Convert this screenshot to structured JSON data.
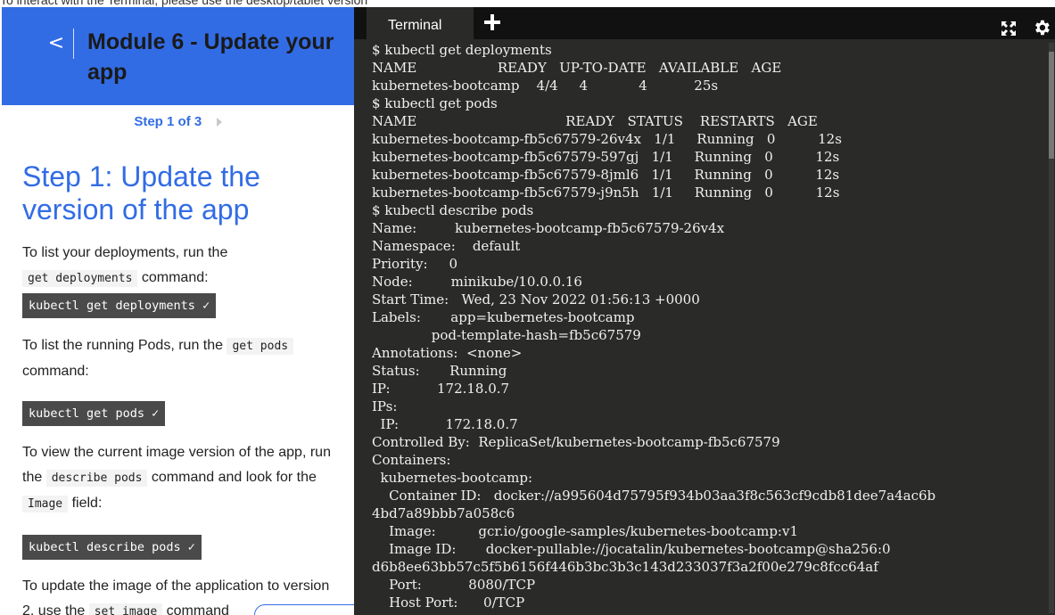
{
  "top_banner": "To interact with the Terminal, please use the desktop/tablet version",
  "left": {
    "back_glyph": "<",
    "module_title": "Module 6 - Update your app",
    "step_label": "Step 1 of 3",
    "step_heading": "Step 1: Update the version of the app",
    "para1_a": "To list your deployments, run the",
    "para1_code": "get deployments",
    "para1_b": "command:",
    "cmd1": "kubectl get deployments ✓",
    "para2_a": "To list the running Pods, run the",
    "para2_code": "get pods",
    "para2_b": "command:",
    "cmd2": "kubectl get pods ✓",
    "para3_a": "To view the current image version of the app, run the",
    "para3_code": "describe pods",
    "para3_b": "command and look for the",
    "para3_code2": "Image",
    "para3_c": "field:",
    "cmd3": "kubectl describe pods ✓",
    "para4_a": "To update the image of the application to version 2, use the",
    "para4_code": "set image",
    "para4_b": "command"
  },
  "terminal": {
    "tab_label": "Terminal",
    "lines": [
      "$ kubectl get deployments",
      "NAME                   READY   UP-TO-DATE   AVAILABLE   AGE",
      "kubernetes-bootcamp    4/4     4            4           25s",
      "$ kubectl get pods",
      "NAME                                   READY   STATUS    RESTARTS   AGE",
      "kubernetes-bootcamp-fb5c67579-26v4x   1/1     Running   0          12s",
      "kubernetes-bootcamp-fb5c67579-597gj   1/1     Running   0          12s",
      "kubernetes-bootcamp-fb5c67579-8jml6   1/1     Running   0          12s",
      "kubernetes-bootcamp-fb5c67579-j9n5h   1/1     Running   0          12s",
      "$ kubectl describe pods",
      "Name:         kubernetes-bootcamp-fb5c67579-26v4x",
      "Namespace:    default",
      "Priority:     0",
      "Node:         minikube/10.0.0.16",
      "Start Time:   Wed, 23 Nov 2022 01:56:13 +0000",
      "Labels:       app=kubernetes-bootcamp",
      "              pod-template-hash=fb5c67579",
      "Annotations:  <none>",
      "Status:       Running",
      "IP:           172.18.0.7",
      "IPs:",
      "  IP:           172.18.0.7",
      "Controlled By:  ReplicaSet/kubernetes-bootcamp-fb5c67579",
      "Containers:",
      "  kubernetes-bootcamp:",
      "    Container ID:   docker://a995604d75795f934b03aa3f8c563cf9cdb81dee7a4ac6b",
      "4bd7a89bbb7a058c6",
      "    Image:          gcr.io/google-samples/kubernetes-bootcamp:v1",
      "    Image ID:       docker-pullable://jocatalin/kubernetes-bootcamp@sha256:0",
      "d6b8ee63bb57c5f5b6156f446b3bc3b3c143d233037f3a2f00e279c8fcc64af",
      "    Port:           8080/TCP",
      "    Host Port:      0/TCP"
    ]
  },
  "icons": {
    "expand": "expand-icon",
    "settings": "gear-icon",
    "add": "plus-icon",
    "back": "chevron-left-icon",
    "next": "chevron-right-icon"
  },
  "colors": {
    "accent": "#326ce5",
    "terminal_bg": "#2a2a29",
    "command_button": "#4a4a4a"
  }
}
